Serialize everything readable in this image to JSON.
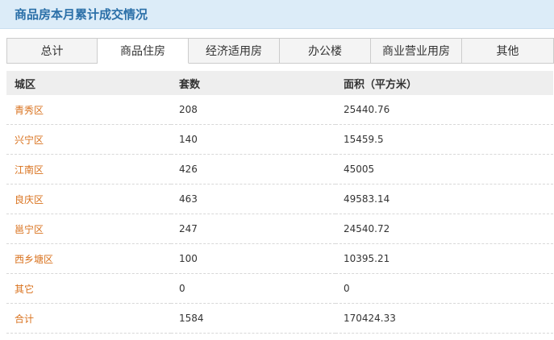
{
  "header": {
    "title": "商品房本月累计成交情况"
  },
  "tabs": [
    {
      "label": "总计",
      "active": false
    },
    {
      "label": "商品住房",
      "active": true
    },
    {
      "label": "经济适用房",
      "active": false
    },
    {
      "label": "办公楼",
      "active": false
    },
    {
      "label": "商业营业用房",
      "active": false
    },
    {
      "label": "其他",
      "active": false
    }
  ],
  "table": {
    "columns": [
      "城区",
      "套数",
      "面积（平方米）"
    ],
    "rows": [
      {
        "district": "青秀区",
        "units": "208",
        "area": "25440.76"
      },
      {
        "district": "兴宁区",
        "units": "140",
        "area": "15459.5"
      },
      {
        "district": "江南区",
        "units": "426",
        "area": "45005"
      },
      {
        "district": "良庆区",
        "units": "463",
        "area": "49583.14"
      },
      {
        "district": "邕宁区",
        "units": "247",
        "area": "24540.72"
      },
      {
        "district": "西乡塘区",
        "units": "100",
        "area": "10395.21"
      },
      {
        "district": "其它",
        "units": "0",
        "area": "0"
      },
      {
        "district": "合计",
        "units": "1584",
        "area": "170424.33"
      }
    ]
  },
  "colors": {
    "header_bg": "#dcecf8",
    "header_text": "#2a6fa8",
    "link": "#d9711c"
  }
}
